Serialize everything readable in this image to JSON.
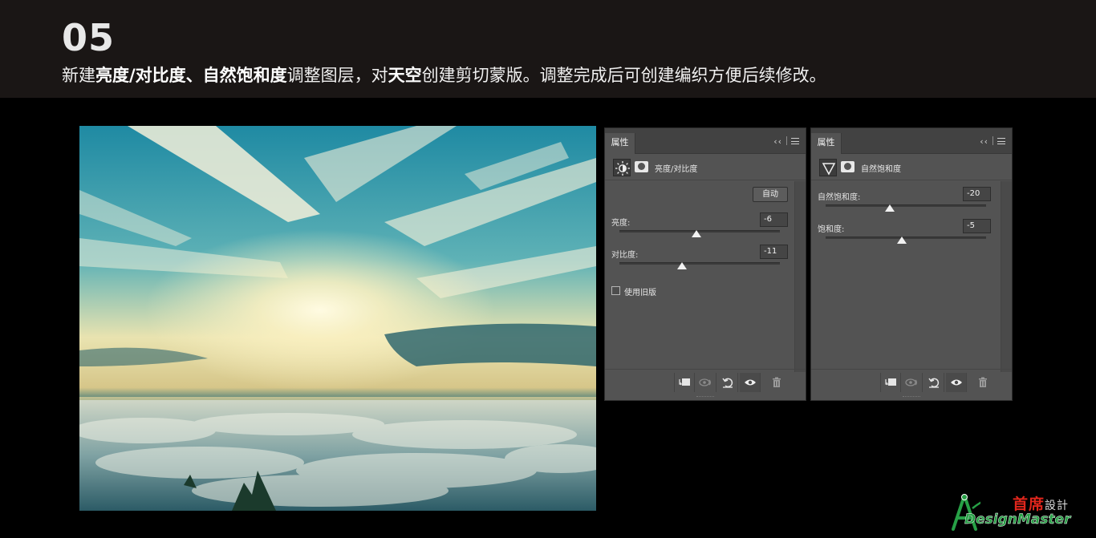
{
  "header": {
    "step_number": "05",
    "instruction": {
      "p1": "新建",
      "b1": "亮度/对比度、自然饱和度",
      "p2": "调整图层，对",
      "b2": "天空",
      "p3": "创建剪切蒙版。调整完成后可创建编织方便后续修改。"
    }
  },
  "panel_brightness": {
    "tab": "属性",
    "tab_menu_collapse": "‹‹",
    "layer_title": "亮度/对比度",
    "auto_button": "自动",
    "brightness": {
      "label": "亮度:",
      "value": "-6",
      "level": 0.48
    },
    "contrast": {
      "label": "对比度:",
      "value": "-11",
      "level": 0.39
    },
    "legacy_label": "使用旧版",
    "legacy_checked": false
  },
  "panel_vibrance": {
    "tab": "属性",
    "tab_menu_collapse": "‹‹",
    "layer_title": "自然饱和度",
    "vibrance": {
      "label": "自然饱和度:",
      "value": "-20",
      "level": 0.4
    },
    "saturation": {
      "label": "饱和度:",
      "value": "-5",
      "level": 0.475
    }
  },
  "icons": {
    "brightness": "sun-icon",
    "vibrance": "triangle-icon",
    "clip": "clip-layer-icon",
    "visibility_prev": "view-previous-icon",
    "reset": "reset-icon",
    "visibility": "eye-icon",
    "delete": "trash-icon"
  },
  "logo": {
    "cn": "首席",
    "cn_small": "設計",
    "en": "DesignMaster"
  },
  "colors": {
    "header_bg": "#1a1615",
    "panel_bg": "#535353",
    "logo_red": "#e0261c",
    "logo_green": "#27a046"
  }
}
